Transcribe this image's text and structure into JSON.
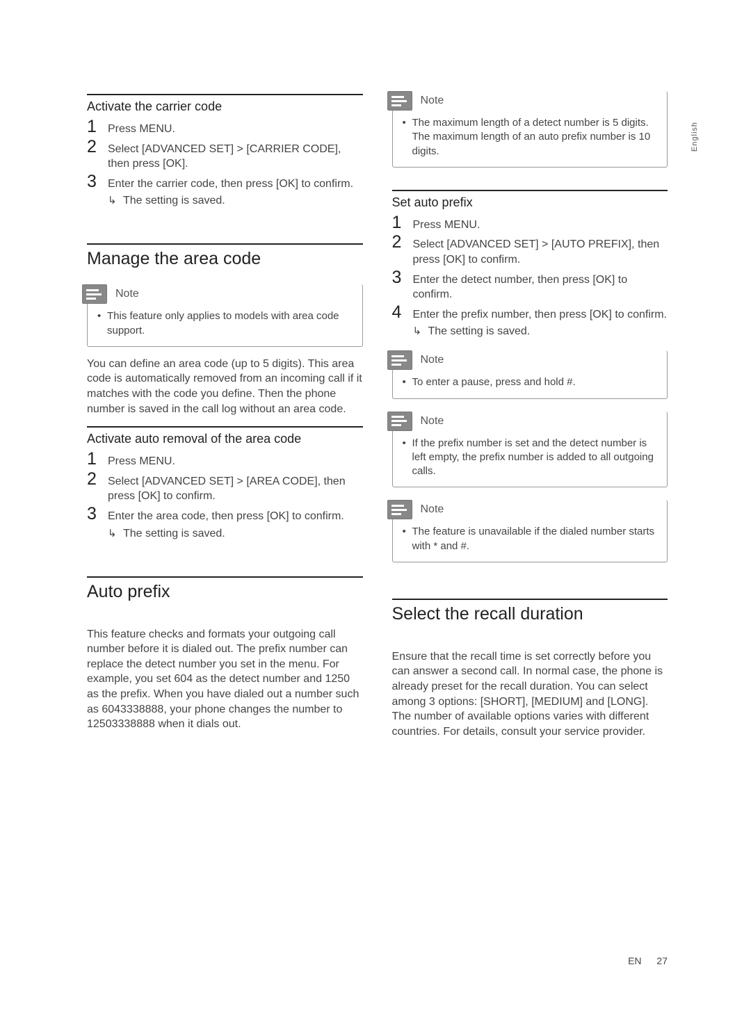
{
  "side_label": "English",
  "footer": {
    "lang": "EN",
    "page": "27"
  },
  "left": {
    "s1": {
      "heading": "Activate the carrier code",
      "steps": [
        {
          "num": "1",
          "text": "Press MENU."
        },
        {
          "num": "2",
          "text": "Select [ADVANCED SET] > [CARRIER CODE], then press [OK]."
        },
        {
          "num": "3",
          "text": "Enter the carrier code, then press [OK] to confirm."
        }
      ],
      "result": "The setting is saved."
    },
    "s2": {
      "heading": "Manage the area code",
      "note_label": "Note",
      "note_items": [
        "This feature only applies to models with area code support."
      ],
      "para": "You can define an area code (up to 5 digits). This area code is automatically removed from an incoming call if it matches with the code you define. Then the phone number is saved in the call log without an area code."
    },
    "s3": {
      "heading": "Activate auto removal of the area code",
      "steps": [
        {
          "num": "1",
          "text": "Press MENU."
        },
        {
          "num": "2",
          "text": "Select [ADVANCED SET] > [AREA CODE], then press [OK] to confirm."
        },
        {
          "num": "3",
          "text": "Enter the area code, then press [OK] to confirm."
        }
      ],
      "result": "The setting is saved."
    },
    "s4": {
      "heading": "Auto prefix",
      "para": "This feature checks and formats your outgoing call number before it is dialed out. The prefix number can replace the detect number you set in the menu. For example, you set 604 as the detect number and 1250 as the prefix. When you have dialed out a number such as 6043338888, your phone changes the number to 12503338888 when it dials out."
    }
  },
  "right": {
    "n1": {
      "label": "Note",
      "items": [
        "The maximum length of a detect number is 5 digits. The maximum length of an auto prefix number is 10 digits."
      ]
    },
    "s5": {
      "heading": "Set auto prefix",
      "steps": [
        {
          "num": "1",
          "text": "Press MENU."
        },
        {
          "num": "2",
          "text": "Select [ADVANCED SET] > [AUTO PREFIX], then press [OK] to confirm."
        },
        {
          "num": "3",
          "text": "Enter the detect number, then press [OK] to confirm."
        },
        {
          "num": "4",
          "text": "Enter the prefix number, then press [OK] to confirm."
        }
      ],
      "result": "The setting is saved."
    },
    "n2": {
      "label": "Note",
      "items": [
        "To enter a pause, press and hold #."
      ]
    },
    "n3": {
      "label": "Note",
      "items": [
        "If the prefix number is set and the detect number is left empty, the prefix number is added to all outgoing calls."
      ]
    },
    "n4": {
      "label": "Note",
      "items": [
        "The feature is unavailable if the dialed number starts with * and #."
      ]
    },
    "s6": {
      "heading": "Select the recall duration",
      "para": "Ensure that the recall time is set correctly before you can answer a second call. In normal case, the phone is already preset for the recall duration. You can select among 3 options: [SHORT], [MEDIUM] and [LONG]. The number of available options varies with different countries. For details, consult your service provider."
    }
  }
}
